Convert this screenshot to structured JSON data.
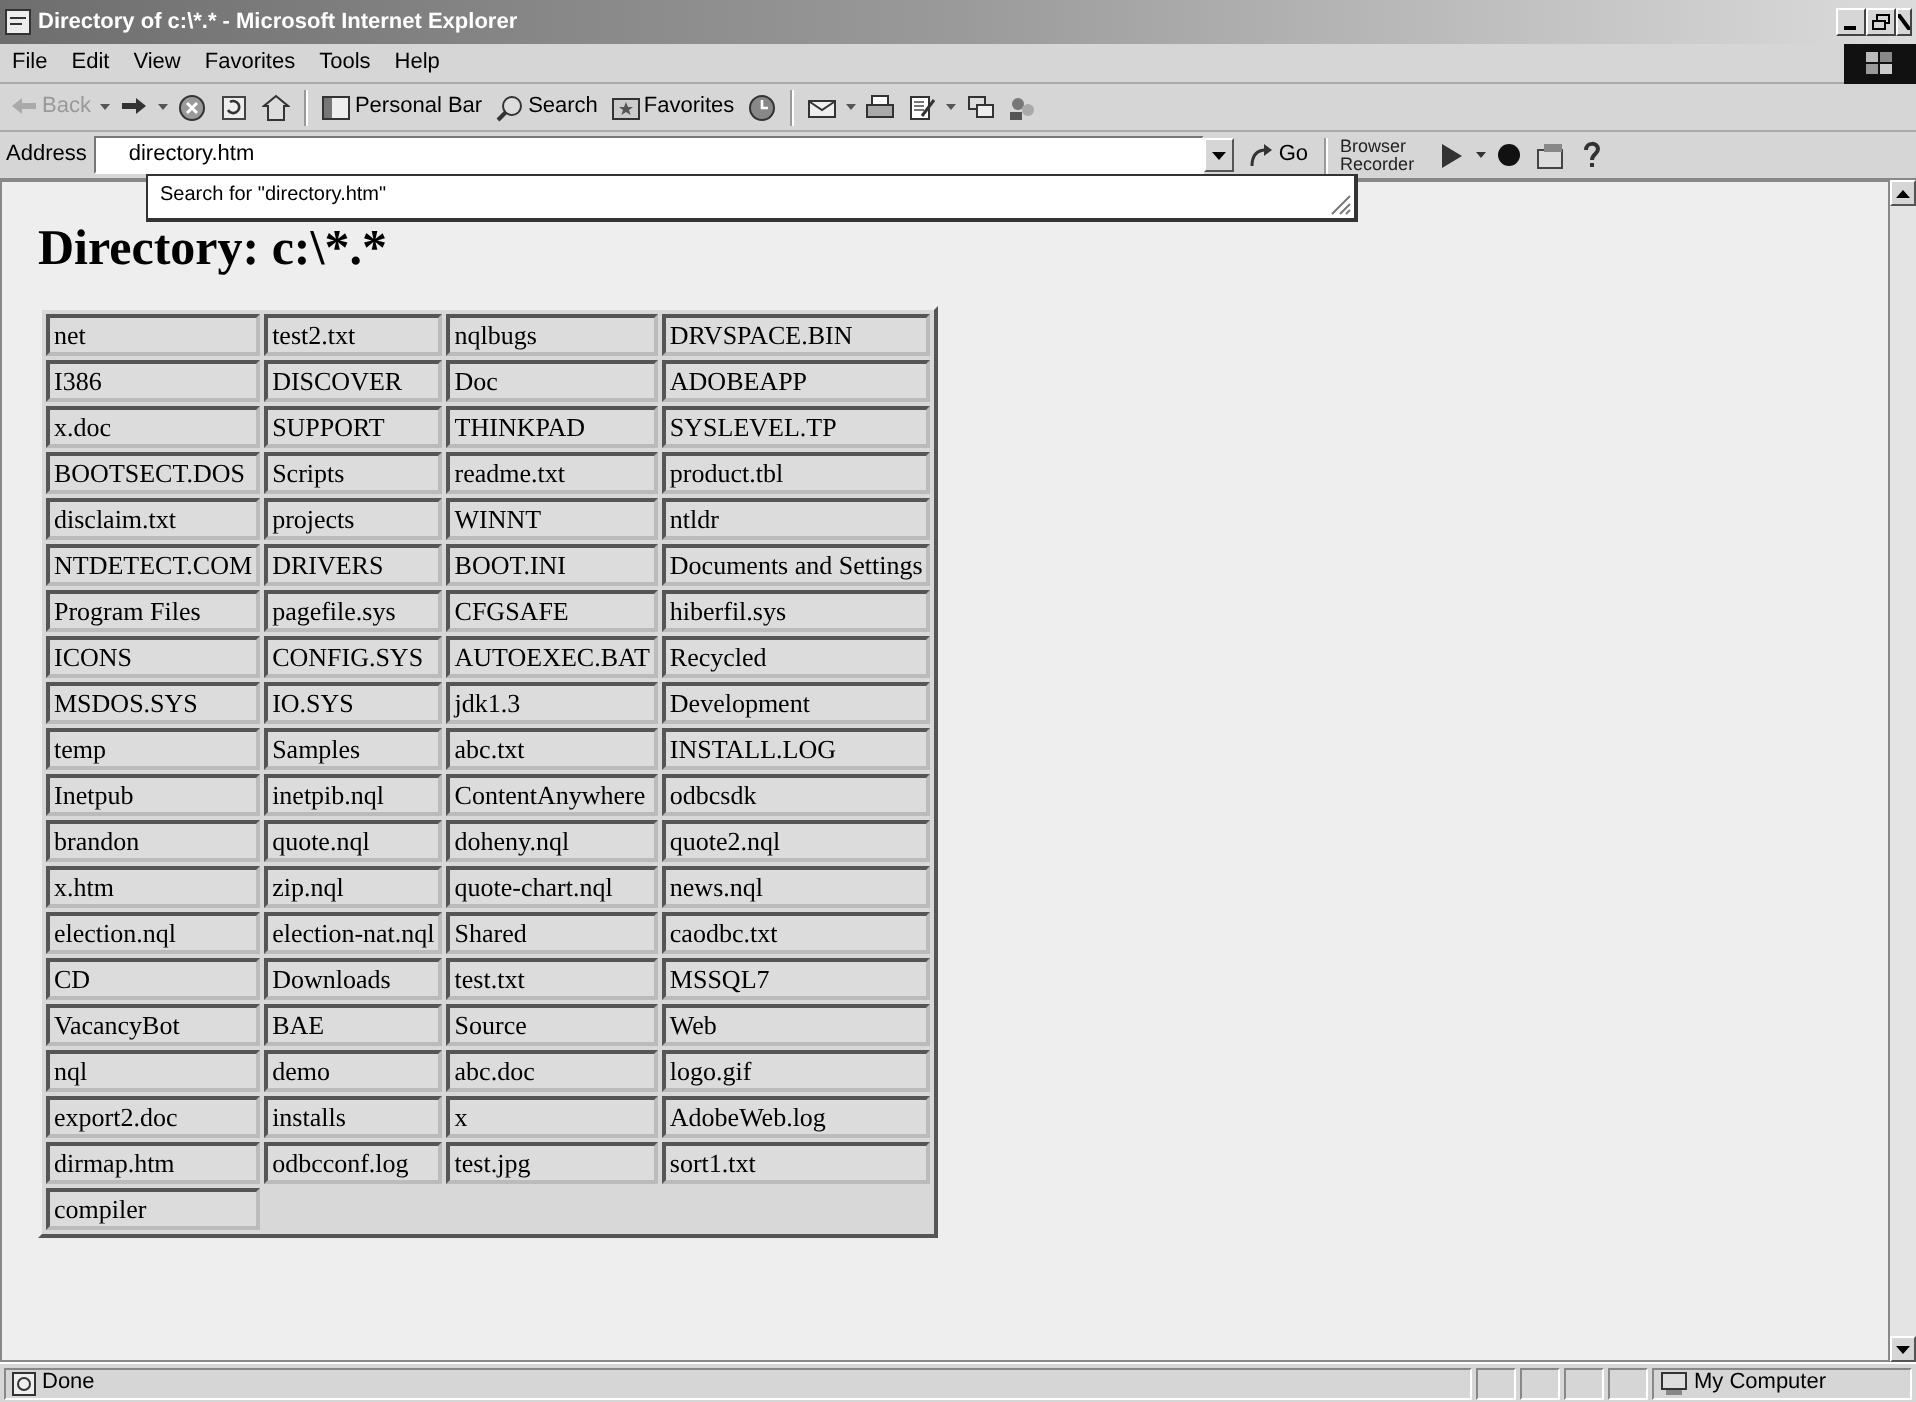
{
  "window": {
    "title": "Directory of c:\\*.* - Microsoft Internet Explorer"
  },
  "menu": [
    "File",
    "Edit",
    "View",
    "Favorites",
    "Tools",
    "Help"
  ],
  "toolbar": [
    {
      "kind": "back",
      "label": "Back",
      "disabled": true
    },
    {
      "kind": "forward",
      "disabled": false
    },
    {
      "kind": "stop"
    },
    {
      "kind": "refresh"
    },
    {
      "kind": "home"
    },
    {
      "kind": "separator"
    },
    {
      "kind": "personal",
      "label": "Personal Bar"
    },
    {
      "kind": "search",
      "label": "Search"
    },
    {
      "kind": "favorites",
      "label": "Favorites"
    },
    {
      "kind": "history"
    },
    {
      "kind": "separator"
    },
    {
      "kind": "mail"
    },
    {
      "kind": "print"
    },
    {
      "kind": "edit"
    },
    {
      "kind": "discuss"
    },
    {
      "kind": "messenger"
    }
  ],
  "address": {
    "label": "Address",
    "value": "directory.htm",
    "suggestion": "Search for \"directory.htm\"",
    "go": "Go",
    "recorder": "Browser Recorder"
  },
  "page": {
    "heading": "Directory: c:\\*.*",
    "rows": [
      [
        "net",
        "test2.txt",
        "nqlbugs",
        "DRVSPACE.BIN"
      ],
      [
        "I386",
        "DISCOVER",
        "Doc",
        "ADOBEAPP"
      ],
      [
        "x.doc",
        "SUPPORT",
        "THINKPAD",
        "SYSLEVEL.TP"
      ],
      [
        "BOOTSECT.DOS",
        "Scripts",
        "readme.txt",
        "product.tbl"
      ],
      [
        "disclaim.txt",
        "projects",
        "WINNT",
        "ntldr"
      ],
      [
        "NTDETECT.COM",
        "DRIVERS",
        "BOOT.INI",
        "Documents and Settings"
      ],
      [
        "Program Files",
        "pagefile.sys",
        "CFGSAFE",
        "hiberfil.sys"
      ],
      [
        "ICONS",
        "CONFIG.SYS",
        "AUTOEXEC.BAT",
        "Recycled"
      ],
      [
        "MSDOS.SYS",
        "IO.SYS",
        "jdk1.3",
        "Development"
      ],
      [
        "temp",
        "Samples",
        "abc.txt",
        "INSTALL.LOG"
      ],
      [
        "Inetpub",
        "inetpib.nql",
        "ContentAnywhere",
        "odbcsdk"
      ],
      [
        "brandon",
        "quote.nql",
        "doheny.nql",
        "quote2.nql"
      ],
      [
        "x.htm",
        "zip.nql",
        "quote-chart.nql",
        "news.nql"
      ],
      [
        "election.nql",
        "election-nat.nql",
        "Shared",
        "caodbc.txt"
      ],
      [
        "CD",
        "Downloads",
        "test.txt",
        "MSSQL7"
      ],
      [
        "VacancyBot",
        "BAE",
        "Source",
        "Web"
      ],
      [
        "nql",
        "demo",
        "abc.doc",
        "logo.gif"
      ],
      [
        "export2.doc",
        "installs",
        "x",
        "AdobeWeb.log"
      ],
      [
        "dirmap.htm",
        "odbcconf.log",
        "test.jpg",
        "sort1.txt"
      ],
      [
        "compiler"
      ]
    ]
  },
  "status_bar": {
    "text": "Done",
    "zone": "My Computer"
  }
}
